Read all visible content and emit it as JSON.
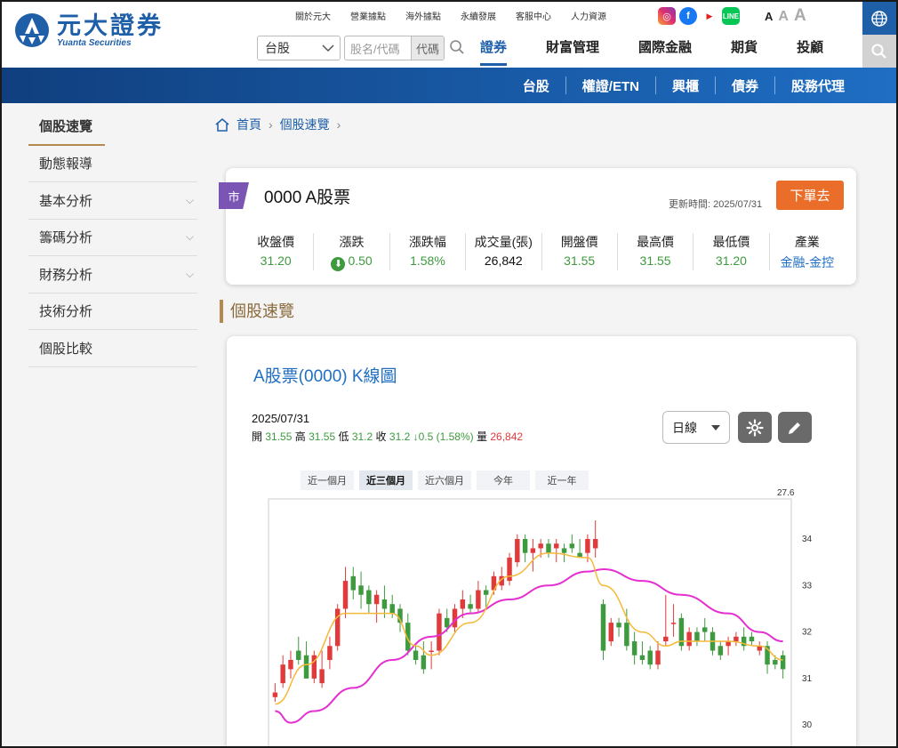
{
  "brand": {
    "name_cn": "元大證券",
    "name_en": "Yuanta Securities"
  },
  "top_links": [
    "關於元大",
    "營業據點",
    "海外據點",
    "永續發展",
    "客服中心",
    "人力資源"
  ],
  "social_icons": [
    "instagram-icon",
    "facebook-icon",
    "youtube-icon",
    "line-icon"
  ],
  "font_sizes": [
    "A",
    "A",
    "A"
  ],
  "search": {
    "market": "台股",
    "placeholder": "股名/代碼",
    "code_label": "代碼"
  },
  "main_nav": [
    {
      "label": "證券",
      "active": true
    },
    {
      "label": "財富管理",
      "active": false
    },
    {
      "label": "國際金融",
      "active": false
    },
    {
      "label": "期貨",
      "active": false
    },
    {
      "label": "投顧",
      "active": false
    }
  ],
  "sub_nav": [
    "台股",
    "權證/ETN",
    "興櫃",
    "債券",
    "股務代理"
  ],
  "sidebar": {
    "items": [
      {
        "label": "個股速覽",
        "expandable": false,
        "active": true
      },
      {
        "label": "動態報導",
        "expandable": false,
        "active": false
      },
      {
        "label": "基本分析",
        "expandable": true,
        "active": false
      },
      {
        "label": "籌碼分析",
        "expandable": true,
        "active": false
      },
      {
        "label": "財務分析",
        "expandable": true,
        "active": false
      },
      {
        "label": "技術分析",
        "expandable": false,
        "active": false
      },
      {
        "label": "個股比較",
        "expandable": false,
        "active": false
      }
    ]
  },
  "breadcrumb": [
    "首頁",
    "個股速覽"
  ],
  "stock": {
    "market_badge": "市",
    "title": "0000 A股票",
    "update_time": "更新時間: 2025/07/31",
    "order_button": "下單去",
    "metrics": [
      {
        "label": "收盤價",
        "value": "31.20",
        "color": "#3e9a3e"
      },
      {
        "label": "漲跌",
        "value": "0.50",
        "color": "#3e9a3e",
        "arrow": "down"
      },
      {
        "label": "漲跌幅",
        "value": "1.58%",
        "color": "#3e9a3e"
      },
      {
        "label": "成交量(張)",
        "value": "26,842",
        "color": "#111111"
      },
      {
        "label": "開盤價",
        "value": "31.55",
        "color": "#3e9a3e"
      },
      {
        "label": "最高價",
        "value": "31.55",
        "color": "#3e9a3e"
      },
      {
        "label": "最低價",
        "value": "31.20",
        "color": "#3e9a3e"
      },
      {
        "label": "產業",
        "value": "金融-金控",
        "color": "#1f6ec4"
      }
    ]
  },
  "section_title": "個股速覽",
  "chart": {
    "title": "A股票(0000)  K線圖",
    "date": "2025/07/31",
    "ohlc": {
      "open_label": "開",
      "open": "31.55",
      "high_label": "高",
      "high": "31.55",
      "low_label": "低",
      "low": "31.2",
      "close_label": "收",
      "close": "31.2",
      "change": "↓0.5 (1.58%)",
      "volume_label": "量",
      "volume": "26,842"
    },
    "period": "日線",
    "ranges": [
      {
        "label": "近一個月",
        "active": false
      },
      {
        "label": "近三個月",
        "active": true
      },
      {
        "label": "近六個月",
        "active": false
      },
      {
        "label": "今年",
        "active": false
      },
      {
        "label": "近一年",
        "active": false
      }
    ],
    "top_value_label": "27.6",
    "colors": {
      "up": "#e03a3a",
      "down": "#3e9a3e",
      "ma_short": "#f5b93a",
      "ma_long": "#e52fd0"
    }
  },
  "chart_data": {
    "type": "candlestick",
    "y_ticks": [
      34,
      33,
      32,
      31,
      30
    ],
    "ylim": [
      29.85,
      34.3
    ],
    "candles": [
      [
        30.6,
        30.9,
        30.5,
        30.7
      ],
      [
        30.9,
        31.5,
        30.8,
        31.3
      ],
      [
        31.2,
        31.6,
        31.0,
        31.4
      ],
      [
        31.6,
        31.9,
        31.3,
        31.4
      ],
      [
        31.5,
        31.8,
        31.2,
        31.0
      ],
      [
        31.0,
        31.6,
        30.9,
        31.5
      ],
      [
        30.9,
        31.6,
        30.8,
        31.2
      ],
      [
        31.4,
        31.9,
        31.2,
        31.7
      ],
      [
        31.7,
        32.6,
        31.6,
        32.5
      ],
      [
        32.5,
        33.4,
        32.3,
        33.1
      ],
      [
        33.2,
        33.4,
        32.7,
        32.9
      ],
      [
        33.0,
        33.3,
        32.5,
        32.8
      ],
      [
        32.9,
        33.0,
        32.4,
        32.6
      ],
      [
        32.6,
        32.9,
        32.2,
        32.8
      ],
      [
        32.7,
        33.0,
        32.3,
        32.5
      ],
      [
        32.6,
        32.8,
        32.3,
        32.4
      ],
      [
        32.5,
        32.6,
        32.0,
        32.2
      ],
      [
        32.2,
        32.4,
        31.5,
        31.6
      ],
      [
        31.6,
        31.7,
        31.3,
        31.4
      ],
      [
        31.5,
        31.8,
        31.1,
        31.2
      ],
      [
        31.6,
        31.8,
        31.2,
        31.6
      ],
      [
        31.6,
        32.5,
        31.5,
        32.4
      ],
      [
        32.3,
        32.5,
        32.0,
        32.1
      ],
      [
        32.1,
        32.6,
        32.0,
        32.5
      ],
      [
        32.5,
        32.9,
        32.3,
        32.7
      ],
      [
        32.6,
        32.8,
        32.4,
        32.5
      ],
      [
        32.5,
        33.1,
        32.4,
        32.9
      ],
      [
        32.9,
        33.0,
        32.5,
        32.8
      ],
      [
        32.9,
        33.3,
        32.8,
        33.2
      ],
      [
        33.0,
        33.4,
        32.9,
        33.2
      ],
      [
        33.1,
        33.7,
        33.0,
        33.6
      ],
      [
        33.5,
        34.1,
        33.4,
        34.0
      ],
      [
        34.0,
        34.1,
        33.5,
        33.7
      ],
      [
        33.7,
        34.0,
        33.3,
        33.8
      ],
      [
        33.8,
        34.0,
        33.6,
        33.9
      ],
      [
        33.9,
        34.0,
        33.6,
        33.7
      ],
      [
        33.8,
        34.0,
        33.5,
        33.9
      ],
      [
        33.8,
        33.9,
        33.5,
        33.7
      ],
      [
        33.9,
        34.1,
        33.7,
        33.8
      ],
      [
        33.7,
        34.0,
        33.6,
        33.6
      ],
      [
        33.7,
        34.1,
        33.5,
        34.0
      ],
      [
        33.8,
        34.4,
        33.6,
        34.0
      ],
      [
        32.6,
        32.7,
        31.4,
        31.6
      ],
      [
        31.8,
        32.3,
        31.7,
        32.2
      ],
      [
        32.2,
        32.3,
        31.9,
        32.1
      ],
      [
        32.2,
        32.5,
        31.6,
        31.7
      ],
      [
        31.8,
        32.0,
        31.3,
        31.5
      ],
      [
        31.5,
        31.8,
        31.3,
        31.4
      ],
      [
        31.6,
        31.7,
        31.2,
        31.3
      ],
      [
        31.3,
        31.8,
        31.2,
        31.6
      ],
      [
        31.8,
        32.8,
        31.7,
        31.9
      ],
      [
        32.2,
        32.6,
        31.9,
        32.2
      ],
      [
        32.3,
        32.4,
        31.6,
        31.7
      ],
      [
        31.7,
        32.1,
        31.6,
        32.0
      ],
      [
        32.0,
        32.1,
        31.7,
        31.8
      ],
      [
        32.1,
        32.3,
        31.8,
        32.0
      ],
      [
        32.0,
        32.1,
        31.5,
        31.6
      ],
      [
        31.7,
        31.8,
        31.4,
        31.5
      ],
      [
        31.7,
        31.9,
        31.5,
        31.8
      ],
      [
        31.8,
        32.0,
        31.7,
        31.9
      ],
      [
        31.9,
        32.1,
        31.6,
        31.7
      ],
      [
        31.9,
        32.0,
        31.7,
        31.8
      ],
      [
        31.6,
        31.8,
        31.5,
        31.7
      ],
      [
        31.7,
        31.8,
        31.1,
        31.3
      ],
      [
        31.4,
        31.5,
        31.2,
        31.3
      ],
      [
        31.5,
        31.6,
        31.0,
        31.2
      ]
    ],
    "ma_short": [
      [
        0,
        30.45
      ],
      [
        4,
        31.3
      ],
      [
        9,
        32.4
      ],
      [
        15,
        32.4
      ],
      [
        18,
        31.7
      ],
      [
        20,
        31.5
      ],
      [
        25,
        32.2
      ],
      [
        30,
        33.2
      ],
      [
        35,
        33.7
      ],
      [
        40,
        33.6
      ],
      [
        42,
        33.0
      ],
      [
        47,
        32.0
      ],
      [
        50,
        31.7
      ],
      [
        52,
        31.8
      ],
      [
        58,
        31.8
      ],
      [
        62,
        31.7
      ],
      [
        65,
        31.4
      ]
    ],
    "ma_long": [
      [
        0,
        30.3
      ],
      [
        2,
        30.05
      ],
      [
        5,
        30.3
      ],
      [
        10,
        30.8
      ],
      [
        15,
        31.4
      ],
      [
        20,
        31.9
      ],
      [
        25,
        32.4
      ],
      [
        30,
        32.7
      ],
      [
        35,
        33.0
      ],
      [
        40,
        33.3
      ],
      [
        42,
        33.35
      ],
      [
        47,
        33.1
      ],
      [
        52,
        32.8
      ],
      [
        58,
        32.4
      ],
      [
        62,
        32.0
      ],
      [
        65,
        31.8
      ]
    ]
  }
}
